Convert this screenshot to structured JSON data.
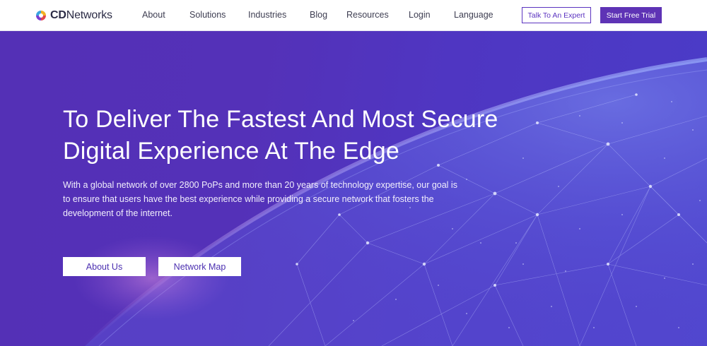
{
  "brand": {
    "name_prefix": "CD",
    "name_suffix": "Networks"
  },
  "nav": {
    "items": [
      "About",
      "Solutions",
      "Industries",
      "Blog",
      "Resources",
      "Login",
      "Language"
    ]
  },
  "header_actions": {
    "talk_label": "Talk To An Expert",
    "trial_label": "Start Free Trial"
  },
  "hero": {
    "title_line1": "To Deliver The Fastest And Most Secure",
    "title_line2": "Digital Experience At The Edge",
    "description": "With a global network of over 2800 PoPs and more than 20 years of technology expertise, our goal is to ensure that users have the best experience while providing a secure network that fosters the development of the internet.",
    "about_label": "About Us",
    "map_label": "Network Map"
  },
  "colors": {
    "brand_purple": "#5e33b5",
    "hero_background": "#5430b6",
    "text_dark": "#3e3e52"
  }
}
